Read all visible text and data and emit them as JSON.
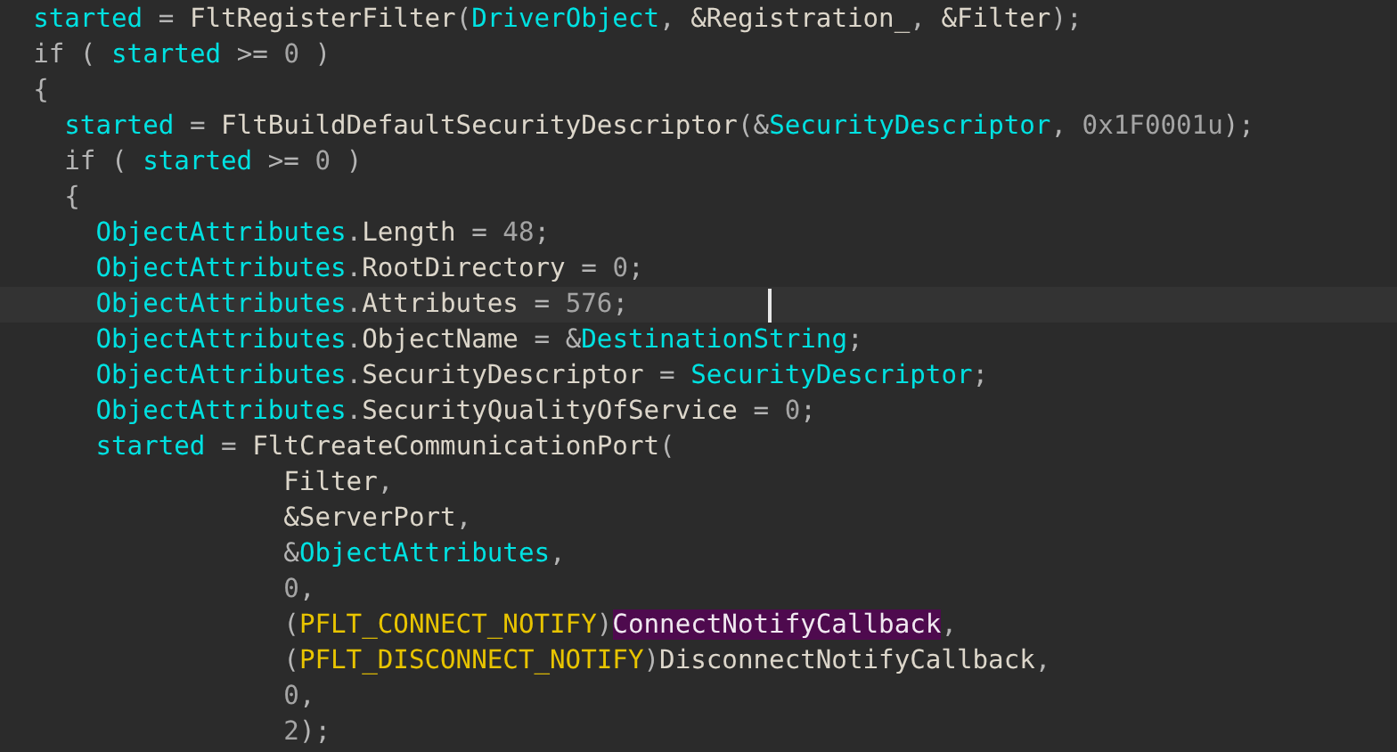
{
  "lines": [
    {
      "selected": false,
      "tokens": [
        {
          "kind": "local",
          "text": "  started"
        },
        {
          "kind": "plain",
          "text": " = "
        },
        {
          "kind": "name",
          "text": "FltRegisterFilter"
        },
        {
          "kind": "plain",
          "text": "("
        },
        {
          "kind": "local",
          "text": "DriverObject"
        },
        {
          "kind": "plain",
          "text": ", "
        },
        {
          "kind": "name",
          "text": "&Registration_"
        },
        {
          "kind": "plain",
          "text": ", "
        },
        {
          "kind": "name",
          "text": "&Filter"
        },
        {
          "kind": "plain",
          "text": ");"
        }
      ]
    },
    {
      "selected": false,
      "tokens": [
        {
          "kind": "plain",
          "text": "  if ( "
        },
        {
          "kind": "local",
          "text": "started"
        },
        {
          "kind": "plain",
          "text": " >= "
        },
        {
          "kind": "number",
          "text": "0"
        },
        {
          "kind": "plain",
          "text": " )"
        }
      ]
    },
    {
      "selected": false,
      "tokens": [
        {
          "kind": "plain",
          "text": "  {"
        }
      ]
    },
    {
      "selected": false,
      "tokens": [
        {
          "kind": "local",
          "text": "    started"
        },
        {
          "kind": "plain",
          "text": " = "
        },
        {
          "kind": "name",
          "text": "FltBuildDefaultSecurityDescriptor"
        },
        {
          "kind": "plain",
          "text": "("
        },
        {
          "kind": "plain",
          "text": "&"
        },
        {
          "kind": "local",
          "text": "SecurityDescriptor"
        },
        {
          "kind": "plain",
          "text": ", "
        },
        {
          "kind": "number",
          "text": "0x1F0001u"
        },
        {
          "kind": "plain",
          "text": ");"
        }
      ]
    },
    {
      "selected": false,
      "tokens": [
        {
          "kind": "plain",
          "text": "    if ( "
        },
        {
          "kind": "local",
          "text": "started"
        },
        {
          "kind": "plain",
          "text": " >= "
        },
        {
          "kind": "number",
          "text": "0"
        },
        {
          "kind": "plain",
          "text": " )"
        }
      ]
    },
    {
      "selected": false,
      "tokens": [
        {
          "kind": "plain",
          "text": "    {"
        }
      ]
    },
    {
      "selected": false,
      "tokens": [
        {
          "kind": "local",
          "text": "      ObjectAttributes"
        },
        {
          "kind": "plain",
          "text": "."
        },
        {
          "kind": "name",
          "text": "Length"
        },
        {
          "kind": "plain",
          "text": " = "
        },
        {
          "kind": "number",
          "text": "48"
        },
        {
          "kind": "plain",
          "text": ";"
        }
      ]
    },
    {
      "selected": false,
      "tokens": [
        {
          "kind": "local",
          "text": "      ObjectAttributes"
        },
        {
          "kind": "plain",
          "text": "."
        },
        {
          "kind": "name",
          "text": "RootDirectory"
        },
        {
          "kind": "plain",
          "text": " = "
        },
        {
          "kind": "number",
          "text": "0"
        },
        {
          "kind": "plain",
          "text": ";"
        }
      ]
    },
    {
      "selected": true,
      "tokens": [
        {
          "kind": "local",
          "text": "      ObjectAttributes"
        },
        {
          "kind": "plain",
          "text": "."
        },
        {
          "kind": "name",
          "text": "Attributes"
        },
        {
          "kind": "plain",
          "text": " = "
        },
        {
          "kind": "number",
          "text": "576"
        },
        {
          "kind": "plain",
          "text": ";"
        }
      ]
    },
    {
      "selected": false,
      "tokens": [
        {
          "kind": "local",
          "text": "      ObjectAttributes"
        },
        {
          "kind": "plain",
          "text": "."
        },
        {
          "kind": "name",
          "text": "ObjectName"
        },
        {
          "kind": "plain",
          "text": " = &"
        },
        {
          "kind": "local",
          "text": "DestinationString"
        },
        {
          "kind": "plain",
          "text": ";"
        }
      ]
    },
    {
      "selected": false,
      "tokens": [
        {
          "kind": "local",
          "text": "      ObjectAttributes"
        },
        {
          "kind": "plain",
          "text": "."
        },
        {
          "kind": "name",
          "text": "SecurityDescriptor"
        },
        {
          "kind": "plain",
          "text": " = "
        },
        {
          "kind": "local",
          "text": "SecurityDescriptor"
        },
        {
          "kind": "plain",
          "text": ";"
        }
      ]
    },
    {
      "selected": false,
      "tokens": [
        {
          "kind": "local",
          "text": "      ObjectAttributes"
        },
        {
          "kind": "plain",
          "text": "."
        },
        {
          "kind": "name",
          "text": "SecurityQualityOfService"
        },
        {
          "kind": "plain",
          "text": " = "
        },
        {
          "kind": "number",
          "text": "0"
        },
        {
          "kind": "plain",
          "text": ";"
        }
      ]
    },
    {
      "selected": false,
      "tokens": [
        {
          "kind": "local",
          "text": "      started"
        },
        {
          "kind": "plain",
          "text": " = "
        },
        {
          "kind": "name",
          "text": "FltCreateCommunicationPort"
        },
        {
          "kind": "plain",
          "text": "("
        }
      ]
    },
    {
      "selected": false,
      "tokens": [
        {
          "kind": "name",
          "text": "                  Filter"
        },
        {
          "kind": "plain",
          "text": ","
        }
      ]
    },
    {
      "selected": false,
      "tokens": [
        {
          "kind": "name",
          "text": "                  &ServerPort"
        },
        {
          "kind": "plain",
          "text": ","
        }
      ]
    },
    {
      "selected": false,
      "tokens": [
        {
          "kind": "plain",
          "text": "                  &"
        },
        {
          "kind": "local",
          "text": "ObjectAttributes"
        },
        {
          "kind": "plain",
          "text": ","
        }
      ]
    },
    {
      "selected": false,
      "tokens": [
        {
          "kind": "number",
          "text": "                  0"
        },
        {
          "kind": "plain",
          "text": ","
        }
      ]
    },
    {
      "selected": false,
      "tokens": [
        {
          "kind": "plain",
          "text": "                  ("
        },
        {
          "kind": "type",
          "text": "PFLT_CONNECT_NOTIFY"
        },
        {
          "kind": "plain",
          "text": ")"
        },
        {
          "kind": "highlight",
          "text": "ConnectNotifyCallback"
        },
        {
          "kind": "plain",
          "text": ","
        }
      ]
    },
    {
      "selected": false,
      "tokens": [
        {
          "kind": "plain",
          "text": "                  ("
        },
        {
          "kind": "type",
          "text": "PFLT_DISCONNECT_NOTIFY"
        },
        {
          "kind": "plain",
          "text": ")"
        },
        {
          "kind": "name",
          "text": "DisconnectNotifyCallback"
        },
        {
          "kind": "plain",
          "text": ","
        }
      ]
    },
    {
      "selected": false,
      "tokens": [
        {
          "kind": "number",
          "text": "                  0"
        },
        {
          "kind": "plain",
          "text": ","
        }
      ]
    },
    {
      "selected": false,
      "tokens": [
        {
          "kind": "number",
          "text": "                  2"
        },
        {
          "kind": "plain",
          "text": ");"
        }
      ]
    }
  ]
}
